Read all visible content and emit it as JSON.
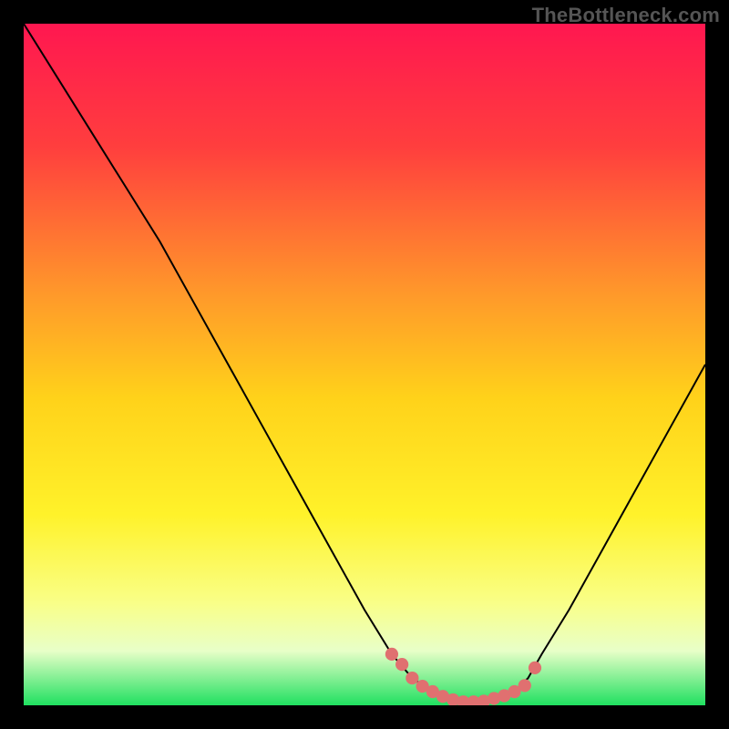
{
  "watermark": "TheBottleneck.com",
  "colors": {
    "gradient_stops": [
      {
        "offset": 0.0,
        "color": "#ff1750"
      },
      {
        "offset": 0.18,
        "color": "#ff3e3e"
      },
      {
        "offset": 0.4,
        "color": "#ff9a2a"
      },
      {
        "offset": 0.55,
        "color": "#ffd21a"
      },
      {
        "offset": 0.72,
        "color": "#fff22a"
      },
      {
        "offset": 0.85,
        "color": "#f9ff88"
      },
      {
        "offset": 0.92,
        "color": "#e8ffc8"
      },
      {
        "offset": 1.0,
        "color": "#20e060"
      }
    ],
    "curve": "#000000",
    "dots": "#e07070",
    "frame": "#000000"
  },
  "chart_data": {
    "type": "line",
    "xlim": [
      0,
      100
    ],
    "ylim": [
      0,
      100
    ],
    "title": "",
    "xlabel": "",
    "ylabel": "",
    "series": [
      {
        "name": "bottleneck-curve",
        "x": [
          0,
          5,
          10,
          15,
          20,
          25,
          30,
          35,
          40,
          45,
          50,
          54,
          57,
          60,
          62,
          65,
          68,
          70,
          72,
          74,
          76,
          80,
          85,
          90,
          95,
          100
        ],
        "y": [
          100,
          92,
          84,
          76,
          68,
          59,
          50,
          41,
          32,
          23,
          14,
          7.5,
          4.0,
          2.0,
          1.0,
          0.5,
          0.5,
          1.0,
          2.0,
          4.0,
          7.5,
          14,
          23,
          32,
          41,
          50
        ]
      }
    ],
    "markers": {
      "name": "highlight-dots",
      "x": [
        54,
        55.5,
        57,
        58.5,
        60,
        61.5,
        63,
        64.5,
        66,
        67.5,
        69,
        70.5,
        72,
        73.5,
        75
      ],
      "y": [
        7.5,
        6.0,
        4.0,
        2.8,
        2.0,
        1.3,
        0.8,
        0.5,
        0.5,
        0.6,
        1.0,
        1.4,
        2.0,
        2.9,
        5.5
      ]
    }
  }
}
